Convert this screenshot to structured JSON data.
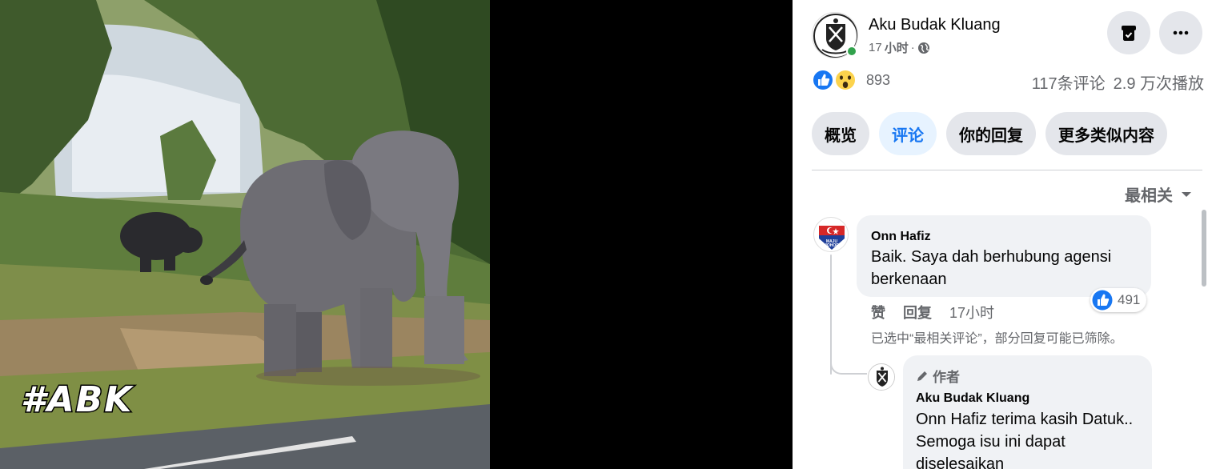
{
  "video": {
    "watermark": "#ABK"
  },
  "header": {
    "page_name": "Aku Budak Kluang",
    "time_num": "17",
    "time_unit": "小时",
    "dot": "·"
  },
  "reactions": {
    "count": "893",
    "comments": "117条评论",
    "views": "2.9 万次播放"
  },
  "tabs": [
    {
      "label": "概览",
      "active": false
    },
    {
      "label": "评论",
      "active": true
    },
    {
      "label": "你的回复",
      "active": false
    },
    {
      "label": "更多类似内容",
      "active": false
    }
  ],
  "sort": {
    "label": "最相关"
  },
  "comment": {
    "author": "Onn Hafiz",
    "text": "Baik. Saya dah berhubung agensi berkenaan",
    "like_count": "491",
    "like_label": "赞",
    "reply_label": "回复",
    "time": "17小时",
    "filter_note": "已选中“最相关评论”，部分回复可能已筛除。",
    "avatar_text": "MAJU JOHOR"
  },
  "reply": {
    "author_tag": "作者",
    "author": "Aku Budak Kluang",
    "mention": "Onn Hafiz",
    "text": " terima kasih Datuk.. Semoga isu ini dapat diselesaikan"
  },
  "colors": {
    "accent": "#1877f2",
    "online": "#31a24c",
    "bubble": "#f0f2f5",
    "muted": "#65676b"
  }
}
